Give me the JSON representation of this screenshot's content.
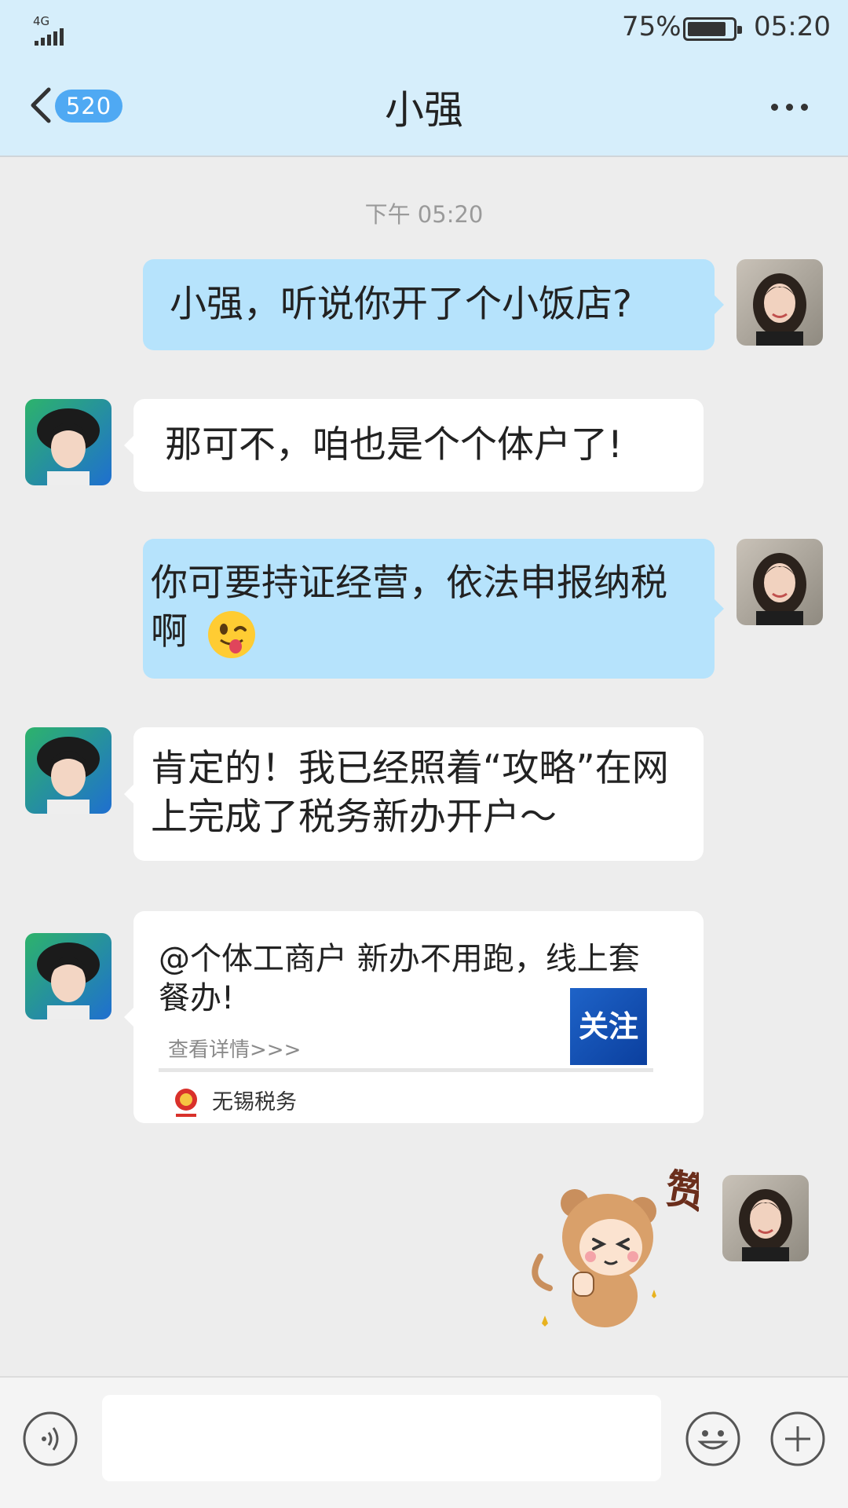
{
  "status_bar": {
    "network": "4G",
    "battery_percent": "75%",
    "battery_level": 0.75,
    "time": "05:20"
  },
  "header": {
    "unread_count": "520",
    "title": "小强",
    "back_icon": "chevron-left-icon",
    "more_icon": "more-dots-icon"
  },
  "chat": {
    "timestamp": "下午 05:20",
    "messages": [
      {
        "sender": "me",
        "text": "小强，听说你开了个小饭店?"
      },
      {
        "sender": "friend",
        "text": "那可不，咱也是个个体户了!"
      },
      {
        "sender": "me",
        "text": "你可要持证经营，依法申报纳税啊",
        "emoji": "winking-tongue-emoji"
      },
      {
        "sender": "friend",
        "text": "肯定的！我已经照着“攻略”在网上完成了税务新办开户～"
      }
    ],
    "share_card": {
      "sender": "friend",
      "title": "@个体工商户 新办不用跑，线上套餐办!",
      "link_text": "查看详情>>>",
      "follow_label": "关注",
      "source_name": "无锡税务",
      "source_icon": "tax-emblem-icon"
    },
    "sticker": {
      "sender": "me",
      "caption": "赞",
      "description": "monkey-thumbs-up-sticker"
    }
  },
  "input_bar": {
    "voice_icon": "voice-icon",
    "input_value": "",
    "emoji_icon": "smiley-icon",
    "plus_icon": "plus-icon"
  },
  "colors": {
    "header_bg": "#d6eefb",
    "chat_bg": "#ededed",
    "my_bubble": "#b6e3fc",
    "friend_bubble": "#ffffff",
    "badge": "#4fa9f3"
  }
}
